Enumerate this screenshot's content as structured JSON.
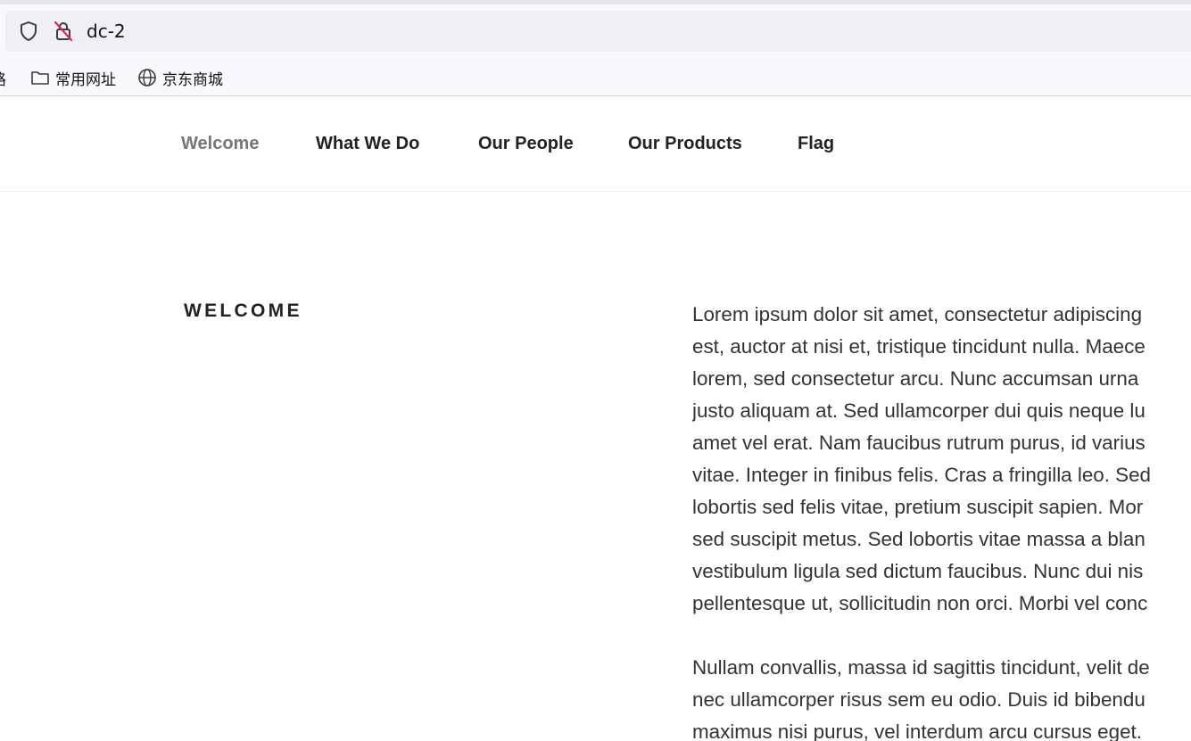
{
  "browser": {
    "url": "dc-2",
    "bookmarks": [
      {
        "label": "路",
        "icon": "none"
      },
      {
        "label": "常用网址",
        "icon": "folder-icon"
      },
      {
        "label": "京东商城",
        "icon": "globe-icon"
      }
    ]
  },
  "nav": {
    "items": [
      {
        "label": "Welcome",
        "active": true
      },
      {
        "label": "What We Do",
        "active": false
      },
      {
        "label": "Our People",
        "active": false
      },
      {
        "label": "Our Products",
        "active": false
      },
      {
        "label": "Flag",
        "active": false
      }
    ]
  },
  "page": {
    "section_title": "WELCOME",
    "paragraph1_lines": [
      "Lorem ipsum dolor sit amet, consectetur adipiscing",
      "est, auctor at nisi et, tristique tincidunt nulla. Maece",
      "lorem, sed consectetur arcu. Nunc accumsan urna",
      "justo aliquam at. Sed ullamcorper dui quis neque lu",
      "amet vel erat. Nam faucibus rutrum purus, id varius",
      "vitae. Integer in finibus felis. Cras a fringilla leo. Sed",
      "lobortis sed felis vitae, pretium suscipit sapien. Mor",
      "sed suscipit metus. Sed lobortis vitae massa a blan",
      "vestibulum ligula sed dictum faucibus. Nunc dui nis",
      "pellentesque ut, sollicitudin non orci. Morbi vel conc"
    ],
    "paragraph2_lines": [
      "Nullam convallis, massa id sagittis tincidunt, velit de",
      "nec ullamcorper risus sem eu odio. Duis id bibendu",
      "maximus nisi purus, vel interdum arcu cursus eget."
    ]
  },
  "colors": {
    "nav_active": "#767676",
    "nav_text": "#222222",
    "body_text": "#333333"
  }
}
